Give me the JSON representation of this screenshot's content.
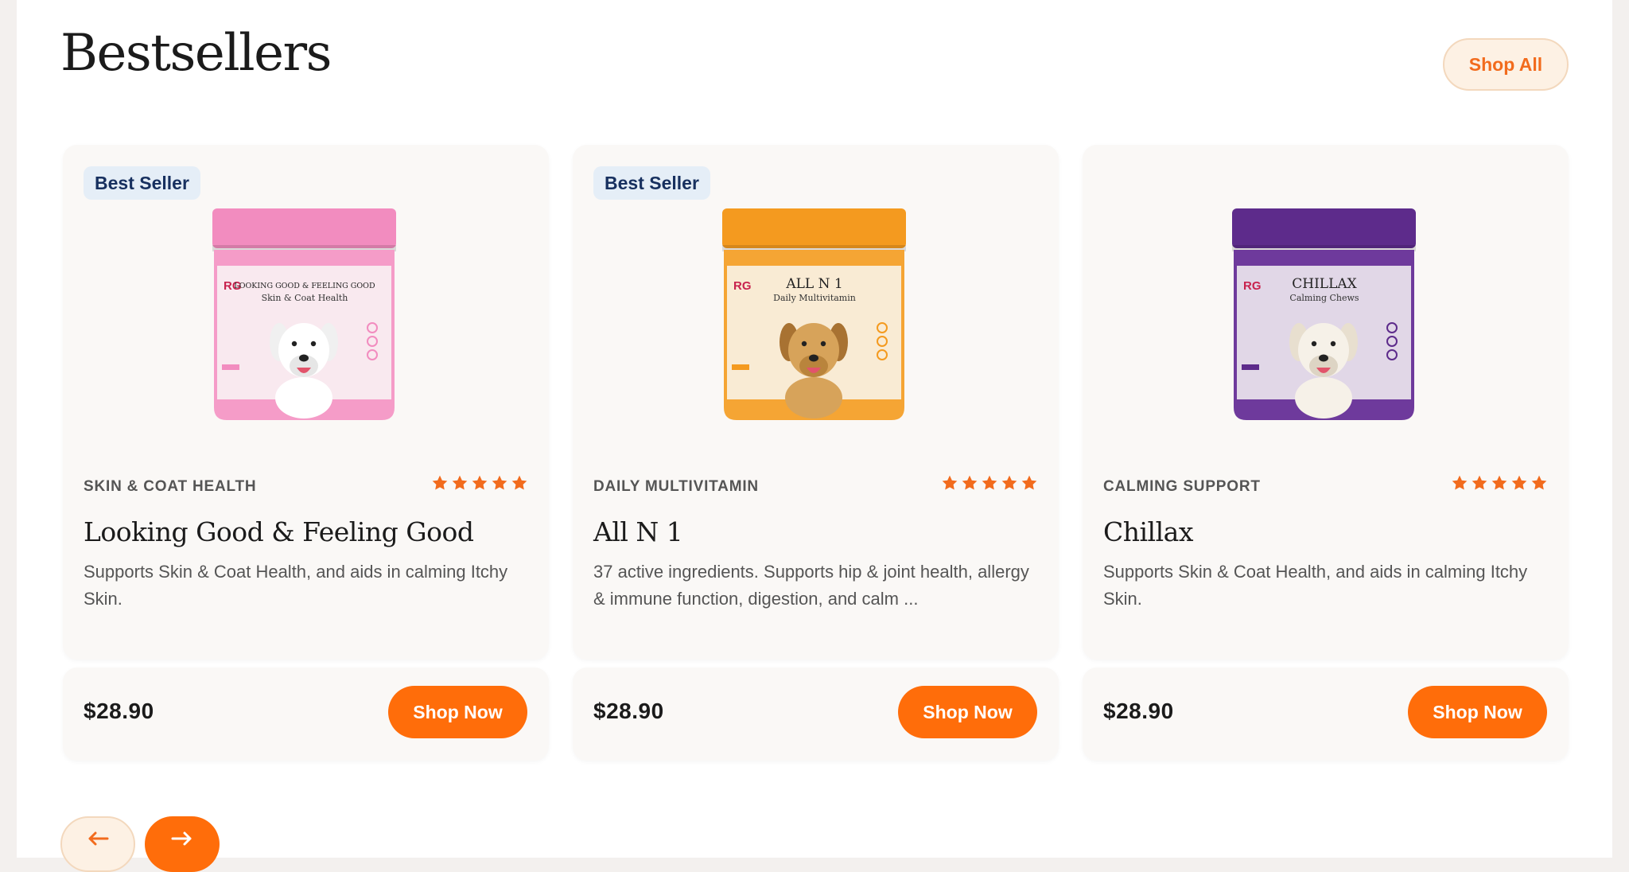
{
  "header": {
    "title": "Bestsellers",
    "shop_all_label": "Shop All"
  },
  "colors": {
    "accent": "#ff6d0a",
    "badge_bg": "#e5eef7",
    "badge_text": "#17305f",
    "star": "#f26b1d",
    "card_bg": "#faf8f6"
  },
  "products": [
    {
      "badge": "Best Seller",
      "category": "SKIN & COAT HEALTH",
      "rating": 5,
      "name": "Looking Good & Feeling Good",
      "description": "Supports Skin & Coat Health, and aids in calming Itchy Skin.",
      "price": "$28.90",
      "button_label": "Shop Now",
      "jar": {
        "color": "#f59cc8",
        "lid_color": "#f28cbf",
        "label_title": "LOOKING GOOD & FEELING GOOD",
        "label_subtitle": "Skin & Coat Health",
        "brand": "RG",
        "dog": "white-dog"
      }
    },
    {
      "badge": "Best Seller",
      "category": "DAILY MULTIVITAMIN",
      "rating": 5,
      "name": "All N 1",
      "description": "37 active ingredients. Supports hip & joint health, allergy & immune function, digestion, and calm ...",
      "price": "$28.90",
      "button_label": "Shop Now",
      "jar": {
        "color": "#f5a534",
        "lid_color": "#f49a1f",
        "label_title": "ALL N 1",
        "label_subtitle": "Daily Multivitamin",
        "brand": "RG",
        "dog": "golden-dog"
      }
    },
    {
      "badge": "",
      "category": "CALMING SUPPORT",
      "rating": 5,
      "name": "Chillax",
      "description": "Supports Skin & Coat Health, and aids in calming Itchy Skin.",
      "price": "$28.90",
      "button_label": "Shop Now",
      "jar": {
        "color": "#6e3a9c",
        "lid_color": "#5d2b8b",
        "label_title": "CHILLAX",
        "label_subtitle": "Calming Chews",
        "brand": "RG",
        "dog": "cream-dog"
      }
    }
  ],
  "carousel": {
    "prev_icon": "arrow-left-icon",
    "next_icon": "arrow-right-icon"
  }
}
